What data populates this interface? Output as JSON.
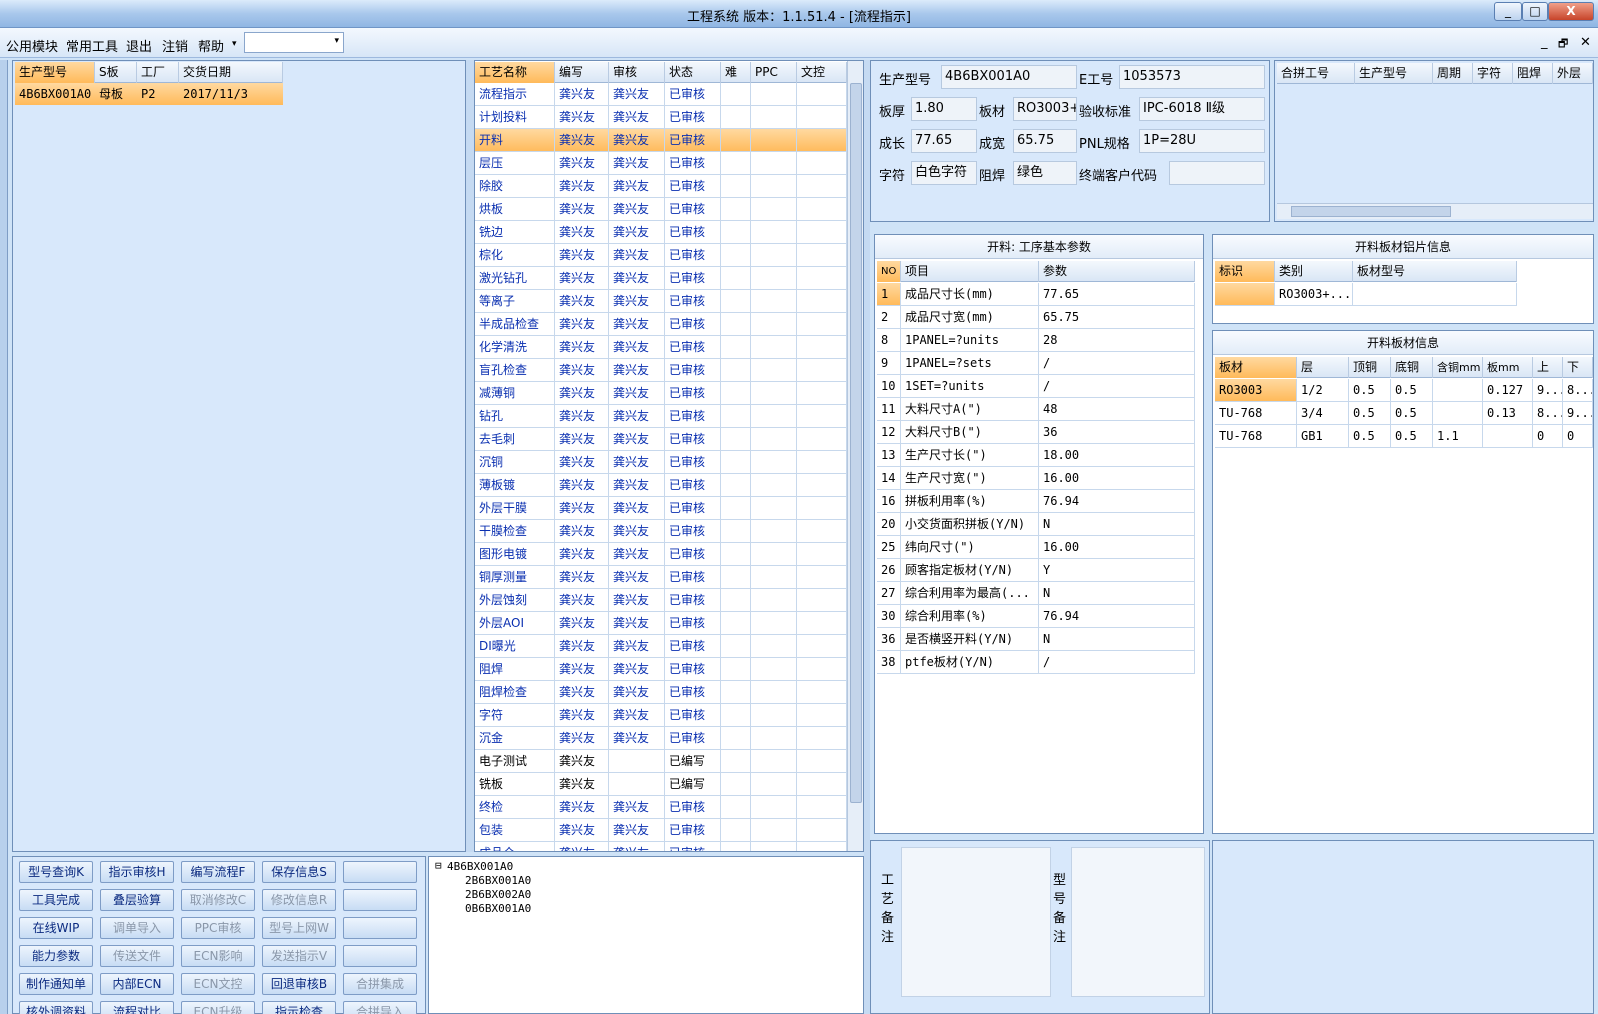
{
  "window": {
    "title": "工程系统   版本：1.1.51.4 - [流程指示]",
    "min": "_",
    "max": "□",
    "close": "X"
  },
  "menu": {
    "items": [
      "公用模块",
      "常用工具",
      "退出",
      "注销",
      "帮助"
    ],
    "combo_arrow": "▾",
    "mdi_min": "_",
    "mdi_restore": "🗗",
    "mdi_close": "✕"
  },
  "orders": {
    "headers": [
      "生产型号",
      "S板",
      "工厂",
      "交货日期"
    ],
    "rows": [
      {
        "model": "4B6BX001A0",
        "board": "母板",
        "factory": "P2",
        "date": "2017/11/3"
      }
    ]
  },
  "process": {
    "headers": [
      "工艺名称",
      "编写",
      "审核",
      "状态",
      "难",
      "PPC",
      "文控"
    ],
    "rows": [
      [
        "流程指示",
        "龚兴友",
        "龚兴友",
        "已审核"
      ],
      [
        "计划投料",
        "龚兴友",
        "龚兴友",
        "已审核"
      ],
      [
        "开料",
        "龚兴友",
        "龚兴友",
        "已审核"
      ],
      [
        "层压",
        "龚兴友",
        "龚兴友",
        "已审核"
      ],
      [
        "除胶",
        "龚兴友",
        "龚兴友",
        "已审核"
      ],
      [
        "烘板",
        "龚兴友",
        "龚兴友",
        "已审核"
      ],
      [
        "铣边",
        "龚兴友",
        "龚兴友",
        "已审核"
      ],
      [
        "棕化",
        "龚兴友",
        "龚兴友",
        "已审核"
      ],
      [
        "激光钻孔",
        "龚兴友",
        "龚兴友",
        "已审核"
      ],
      [
        "等离子",
        "龚兴友",
        "龚兴友",
        "已审核"
      ],
      [
        "半成品检查",
        "龚兴友",
        "龚兴友",
        "已审核"
      ],
      [
        "化学清洗",
        "龚兴友",
        "龚兴友",
        "已审核"
      ],
      [
        "盲孔检查",
        "龚兴友",
        "龚兴友",
        "已审核"
      ],
      [
        "减薄铜",
        "龚兴友",
        "龚兴友",
        "已审核"
      ],
      [
        "钻孔",
        "龚兴友",
        "龚兴友",
        "已审核"
      ],
      [
        "去毛刺",
        "龚兴友",
        "龚兴友",
        "已审核"
      ],
      [
        "沉铜",
        "龚兴友",
        "龚兴友",
        "已审核"
      ],
      [
        "薄板镀",
        "龚兴友",
        "龚兴友",
        "已审核"
      ],
      [
        "外层干膜",
        "龚兴友",
        "龚兴友",
        "已审核"
      ],
      [
        "干膜检查",
        "龚兴友",
        "龚兴友",
        "已审核"
      ],
      [
        "图形电镀",
        "龚兴友",
        "龚兴友",
        "已审核"
      ],
      [
        "铜厚测量",
        "龚兴友",
        "龚兴友",
        "已审核"
      ],
      [
        "外层蚀刻",
        "龚兴友",
        "龚兴友",
        "已审核"
      ],
      [
        "外层AOI",
        "龚兴友",
        "龚兴友",
        "已审核"
      ],
      [
        "DI曝光",
        "龚兴友",
        "龚兴友",
        "已审核"
      ],
      [
        "阻焊",
        "龚兴友",
        "龚兴友",
        "已审核"
      ],
      [
        "阻焊检查",
        "龚兴友",
        "龚兴友",
        "已审核"
      ],
      [
        "字符",
        "龚兴友",
        "龚兴友",
        "已审核"
      ],
      [
        "沉金",
        "龚兴友",
        "龚兴友",
        "已审核"
      ],
      [
        "电子测试",
        "龚兴友",
        "",
        "已编写"
      ],
      [
        "铣板",
        "龚兴友",
        "",
        "已编写"
      ],
      [
        "终检",
        "龚兴友",
        "龚兴友",
        "已审核"
      ],
      [
        "包装",
        "龚兴友",
        "龚兴友",
        "已审核"
      ],
      [
        "成品仓",
        "龚兴友",
        "龚兴友",
        "已审核"
      ]
    ]
  },
  "buttons": [
    [
      "型号查询K",
      "指示审核H",
      "编写流程F",
      "保存信息S",
      ""
    ],
    [
      "工具完成",
      "叠层验算",
      "取消修改C",
      "修改信息R",
      ""
    ],
    [
      "在线WIP",
      "调单导入",
      "PPC审核",
      "型号上网W",
      ""
    ],
    [
      "能力参数",
      "传送文件",
      "ECN影响",
      "发送指示V",
      ""
    ],
    [
      "制作通知单",
      "内部ECN",
      "ECN文控",
      "回退审核B",
      "合拼集成"
    ],
    [
      "核外调资料",
      "流程对比",
      "ECN升级",
      "指示检查",
      "合拼导入"
    ]
  ],
  "tree": {
    "root": "4B6BX001A0",
    "children": [
      "2B6BX001A0",
      "2B6BX002A0",
      "0B6BX001A0"
    ]
  },
  "info": {
    "model_label": "生产型号",
    "model": "4B6BX001A0",
    "e_label": "E工号",
    "e_no": "1053573",
    "thick_label": "板厚",
    "thick": "1.80",
    "mat_label": "板材",
    "mat": "RO3003+",
    "std_label": "验收标准",
    "std": "IPC-6018 Ⅱ级",
    "len_label": "成长",
    "len": "77.65",
    "wid_label": "成宽",
    "wid": "65.75",
    "pnl_label": "PNL规格",
    "pnl": "1P=28U",
    "char_label": "字符",
    "char": "白色字符",
    "mask_label": "阻焊",
    "mask": "绿色",
    "cust_label": "终端客户代码",
    "cust": ""
  },
  "merge": {
    "headers": [
      "合拼工号",
      "生产型号",
      "周期",
      "字符",
      "阻焊",
      "外层"
    ]
  },
  "params": {
    "title": "开料: 工序基本参数",
    "headers": [
      "NO",
      "项目",
      "参数"
    ],
    "rows": [
      [
        "1",
        "成品尺寸长(mm)",
        "77.65"
      ],
      [
        "2",
        "成品尺寸宽(mm)",
        "65.75"
      ],
      [
        "8",
        "1PANEL=?units",
        "28"
      ],
      [
        "9",
        "1PANEL=?sets",
        "/"
      ],
      [
        "10",
        "1SET=?units",
        "/"
      ],
      [
        "11",
        "大料尺寸A(\")",
        "48"
      ],
      [
        "12",
        "大料尺寸B(\")",
        "36"
      ],
      [
        "13",
        "生产尺寸长(\")",
        "18.00"
      ],
      [
        "14",
        "生产尺寸宽(\")",
        "16.00"
      ],
      [
        "16",
        "拼板利用率(%)",
        "76.94"
      ],
      [
        "20",
        "小交货面积拼板(Y/N)",
        "N"
      ],
      [
        "25",
        "纬向尺寸(\")",
        "16.00"
      ],
      [
        "26",
        "顾客指定板材(Y/N)",
        "Y"
      ],
      [
        "27",
        "综合利用率为最高(...",
        "N"
      ],
      [
        "30",
        "综合利用率(%)",
        "76.94"
      ],
      [
        "36",
        "是否横竖开料(Y/N)",
        "N"
      ],
      [
        "38",
        "ptfe板材(Y/N)",
        "/"
      ]
    ]
  },
  "alu": {
    "title": "开料板材铝片信息",
    "headers": [
      "标识",
      "类别",
      "板材型号"
    ],
    "rows": [
      [
        "",
        "RO3003+...",
        ""
      ]
    ]
  },
  "board": {
    "title": "开料板材信息",
    "headers": [
      "板材",
      "层",
      "顶铜",
      "底铜",
      "含铜mm",
      "板mm",
      "上",
      "下"
    ],
    "rows": [
      [
        "RO3003",
        "1/2",
        "0.5",
        "0.5",
        "",
        "0.127",
        "9...",
        "8..."
      ],
      [
        "TU-768",
        "3/4",
        "0.5",
        "0.5",
        "",
        "0.13",
        "8...",
        "9..."
      ],
      [
        "TU-768",
        "GB1",
        "0.5",
        "0.5",
        "1.1",
        "",
        "0",
        "0"
      ]
    ]
  },
  "remarks": {
    "process_label": "工艺备注",
    "model_label": "型号备注"
  },
  "colors": {
    "selection": "#ffba5a",
    "link_text": "#0a2fb0",
    "panel": "#d8e8fb"
  }
}
